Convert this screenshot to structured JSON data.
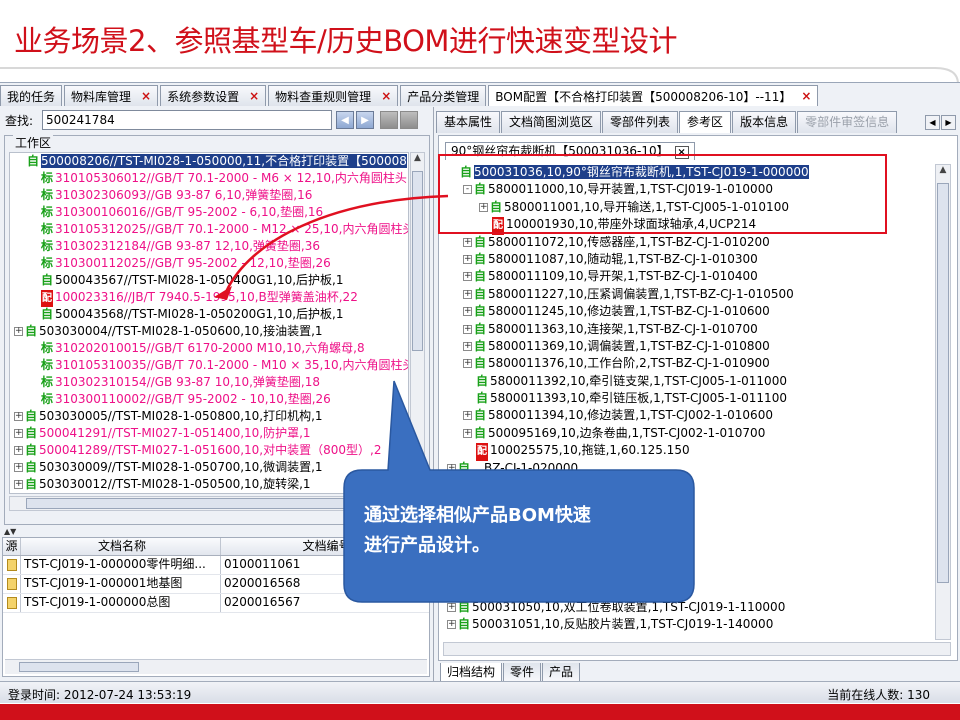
{
  "slide": {
    "title": "业务场景2、参照基型车/历史BOM进行快速变型设计",
    "accent": "#d0101a",
    "callout": {
      "line1": "通过选择相似产品BOM快速",
      "line2": "进行产品设计。",
      "fill": "#3a6fc0"
    }
  },
  "top_tabs": [
    {
      "label": "我的任务",
      "closable": false
    },
    {
      "label": "物料库管理",
      "closable": true
    },
    {
      "label": "系统参数设置",
      "closable": true
    },
    {
      "label": "物料查重规则管理",
      "closable": true
    },
    {
      "label": "产品分类管理",
      "closable": false
    },
    {
      "label": "BOM配置【不合格打印装置【500008206-10】--11】",
      "closable": true,
      "active": true
    }
  ],
  "close_glyph": "×",
  "left": {
    "search_label": "查找:",
    "search_value": "500241784",
    "workarea_label": "工作区",
    "tree": [
      {
        "text": "500008206//TST-MI028-1-050000,11,不合格打印装置【500008",
        "icon": "自",
        "color": "black",
        "exp": "",
        "indent": 0,
        "selected": true
      },
      {
        "text": "310105306012//GB/T 70.1-2000 - M6 × 12,10,内六角圆柱头",
        "icon": "标",
        "color": "red",
        "exp": "",
        "indent": 1
      },
      {
        "text": "310302306093//GB 93-87  6,10,弹簧垫圈,16",
        "icon": "标",
        "color": "red",
        "exp": "",
        "indent": 1
      },
      {
        "text": "310300106016//GB/T 95-2002 - 6,10,垫圈,16",
        "icon": "标",
        "color": "red",
        "exp": "",
        "indent": 1
      },
      {
        "text": "310105312025//GB/T 70.1-2000 - M12 × 25,10,内六角圆柱头",
        "icon": "标",
        "color": "red",
        "exp": "",
        "indent": 1
      },
      {
        "text": "310302312184//GB 93-87  12,10,弹簧垫圈,36",
        "icon": "标",
        "color": "red",
        "exp": "",
        "indent": 1
      },
      {
        "text": "310300112025//GB/T 95-2002 - 12,10,垫圈,26",
        "icon": "标",
        "color": "red",
        "exp": "",
        "indent": 1
      },
      {
        "text": "500043567//TST-MI028-1-050400G1,10,后护板,1",
        "icon": "自",
        "color": "black",
        "exp": "",
        "indent": 1
      },
      {
        "text": "100023316//JB/T 7940.5-1995,10,B型弹簧盖油杯,22",
        "icon": "配",
        "color": "red",
        "exp": "",
        "indent": 1
      },
      {
        "text": "500043568//TST-MI028-1-050200G1,10,后护板,1",
        "icon": "自",
        "color": "black",
        "exp": "",
        "indent": 1
      },
      {
        "text": "503030004//TST-MI028-1-050600,10,接油装置,1",
        "icon": "自",
        "color": "black",
        "exp": "+",
        "indent": 0
      },
      {
        "text": "310202010015//GB/T 6170-2000 M10,10,六角螺母,8",
        "icon": "标",
        "color": "red",
        "exp": "",
        "indent": 1
      },
      {
        "text": "310105310035//GB/T 70.1-2000 - M10 × 35,10,内六角圆柱头",
        "icon": "标",
        "color": "red",
        "exp": "",
        "indent": 1
      },
      {
        "text": "310302310154//GB 93-87  10,10,弹簧垫圈,18",
        "icon": "标",
        "color": "red",
        "exp": "",
        "indent": 1
      },
      {
        "text": "310300110002//GB/T 95-2002 - 10,10,垫圈,26",
        "icon": "标",
        "color": "red",
        "exp": "",
        "indent": 1
      },
      {
        "text": "503030005//TST-MI028-1-050800,10,打印机构,1",
        "icon": "自",
        "color": "black",
        "exp": "+",
        "indent": 0
      },
      {
        "text": "500041291//TST-MI027-1-051400,10,防护罩,1",
        "icon": "自",
        "color": "red",
        "exp": "+",
        "indent": 0
      },
      {
        "text": "500041289//TST-MI027-1-051600,10,对中装置（800型）,2",
        "icon": "自",
        "color": "red",
        "exp": "+",
        "indent": 0
      },
      {
        "text": "503030009//TST-MI028-1-050700,10,微调装置,1",
        "icon": "自",
        "color": "black",
        "exp": "+",
        "indent": 0
      },
      {
        "text": "503030012//TST-MI028-1-050500,10,旋转梁,1",
        "icon": "自",
        "color": "black",
        "exp": "+",
        "indent": 0
      }
    ],
    "doc_table": {
      "headers": [
        "源",
        "文档名称",
        "文档编号"
      ],
      "rows": [
        {
          "name": "TST-CJ019-1-000000零件明细...",
          "code": "0100011061"
        },
        {
          "name": "TST-CJ019-1-000001地基图",
          "code": "0200016568"
        },
        {
          "name": "TST-CJ019-1-000000总图",
          "code": "0200016567"
        }
      ]
    }
  },
  "right": {
    "sub_tabs": [
      {
        "label": "基本属性"
      },
      {
        "label": "文档简图浏览区"
      },
      {
        "label": "零部件列表"
      },
      {
        "label": "参考区",
        "active": true
      },
      {
        "label": "版本信息"
      },
      {
        "label": "零部件审签信息",
        "disabled": true
      }
    ],
    "inner_tab": "90°钢丝帘布裁断机【500031036-10】",
    "tree": [
      {
        "text": "500031036,10,90°钢丝帘布裁断机,1,TST-CJ019-1-000000",
        "icon": "自",
        "exp": "",
        "indent": 0,
        "selected": true
      },
      {
        "text": "5800011000,10,导开装置,1,TST-CJ019-1-010000",
        "icon": "自",
        "exp": "-",
        "indent": 1
      },
      {
        "text": "5800011001,10,导开输送,1,TST-CJ005-1-010100",
        "icon": "自",
        "exp": "+",
        "indent": 2
      },
      {
        "text": "100001930,10,带座外球面球轴承,4,UCP214",
        "icon": "配",
        "exp": "",
        "indent": 2
      },
      {
        "text": "5800011072,10,传感器座,1,TST-BZ-CJ-1-010200",
        "icon": "自",
        "exp": "+",
        "indent": 1
      },
      {
        "text": "5800011087,10,随动辊,1,TST-BZ-CJ-1-010300",
        "icon": "自",
        "exp": "+",
        "indent": 1
      },
      {
        "text": "5800011109,10,导开架,1,TST-BZ-CJ-1-010400",
        "icon": "自",
        "exp": "+",
        "indent": 1
      },
      {
        "text": "5800011227,10,压紧调偏装置,1,TST-BZ-CJ-1-010500",
        "icon": "自",
        "exp": "+",
        "indent": 1
      },
      {
        "text": "5800011245,10,修边装置,1,TST-BZ-CJ-1-010600",
        "icon": "自",
        "exp": "+",
        "indent": 1
      },
      {
        "text": "5800011363,10,连接架,1,TST-BZ-CJ-1-010700",
        "icon": "自",
        "exp": "+",
        "indent": 1
      },
      {
        "text": "5800011369,10,调偏装置,1,TST-BZ-CJ-1-010800",
        "icon": "自",
        "exp": "+",
        "indent": 1
      },
      {
        "text": "5800011376,10,工作台阶,2,TST-BZ-CJ-1-010900",
        "icon": "自",
        "exp": "+",
        "indent": 1
      },
      {
        "text": "5800011392,10,牵引链支架,1,TST-CJ005-1-011000",
        "icon": "自",
        "exp": "",
        "indent": 1
      },
      {
        "text": "5800011393,10,牵引链压板,1,TST-CJ005-1-011100",
        "icon": "自",
        "exp": "",
        "indent": 1
      },
      {
        "text": "5800011394,10,修边装置,1,TST-CJ002-1-010600",
        "icon": "自",
        "exp": "+",
        "indent": 1
      },
      {
        "text": "500095169,10,边条卷曲,1,TST-CJ002-1-010700",
        "icon": "自",
        "exp": "+",
        "indent": 1
      },
      {
        "text": "100025575,10,拖链,1,60.125.150",
        "icon": "配",
        "exp": "",
        "indent": 1
      },
      {
        "text": "…BZ-CJ-1-020000",
        "icon": "自",
        "exp": "+",
        "indent": 0
      },
      {
        "text": "…030000",
        "icon": "自",
        "exp": "+",
        "indent": 0
      },
      {
        "text": "…BZ-CJ-1-040000",
        "icon": "自",
        "exp": "+",
        "indent": 0
      },
      {
        "text": "…BZ-CJ-1-050000",
        "icon": "自",
        "exp": "+",
        "indent": 0
      },
      {
        "text": "…BZ-CJ-1-060000",
        "icon": "自",
        "exp": "+",
        "indent": 0
      },
      {
        "text": "…J-1-070000",
        "icon": "自",
        "exp": "+",
        "indent": 0
      },
      {
        "text": "…BZ-CJ-1-080000",
        "icon": "自",
        "exp": "+",
        "indent": 0
      },
      {
        "text": "…019-1-090000",
        "icon": "自",
        "exp": "+",
        "indent": 0
      },
      {
        "text": "500031050,10,双工位卷取装置,1,TST-CJ019-1-110000",
        "icon": "自",
        "exp": "+",
        "indent": 0
      },
      {
        "text": "500031051,10,反贴胶片装置,1,TST-CJ019-1-140000",
        "icon": "自",
        "exp": "+",
        "indent": 0
      }
    ],
    "bottom_tabs": [
      {
        "label": "归档结构",
        "active": true
      },
      {
        "label": "零件"
      },
      {
        "label": "产品"
      }
    ]
  },
  "status": {
    "login": "登录时间:  2012-07-24 13:53:19",
    "online": "当前在线人数:  130"
  }
}
